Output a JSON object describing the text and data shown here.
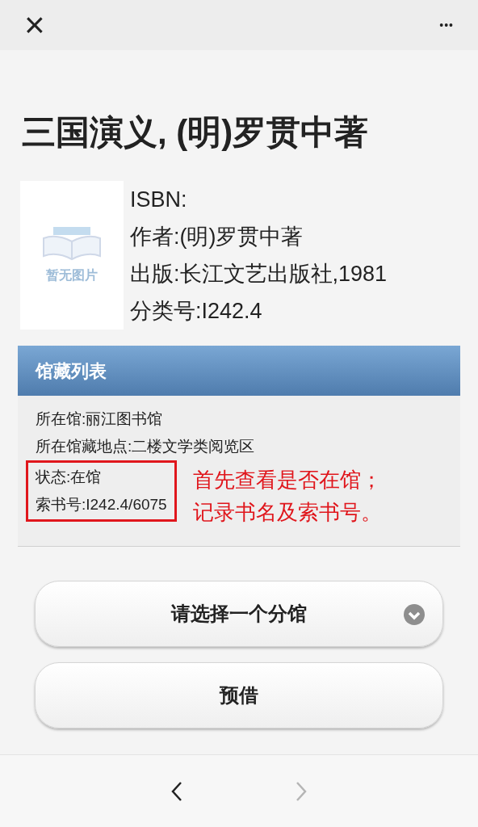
{
  "top_bar": {
    "close": "×",
    "more": "•••"
  },
  "title": "三国演义, (明)罗贯中著",
  "cover": {
    "kind": "picture",
    "placeholder_text": "暂无图片"
  },
  "details": [
    "ISBN:",
    "作者:(明)罗贯中著",
    "出版:长江文艺出版社,1981",
    "分类号:I242.4"
  ],
  "holdings": {
    "header": "馆藏列表",
    "rows": [
      {
        "text": "所在馆:丽江图书馆",
        "highlighted": false
      },
      {
        "text": "所在馆藏地点:二楼文学类阅览区",
        "highlighted": false
      },
      {
        "text": "状态:在馆",
        "highlighted": true
      },
      {
        "text": "索书号:I242.4/6075",
        "highlighted": true
      }
    ],
    "annotation": [
      "首先查看是否在馆；",
      "记录书名及索书号。"
    ]
  },
  "branch_select": {
    "label": "请选择一个分馆"
  },
  "reserve_button": "预借",
  "nav": {
    "back_disabled": false,
    "forward_disabled": true
  }
}
